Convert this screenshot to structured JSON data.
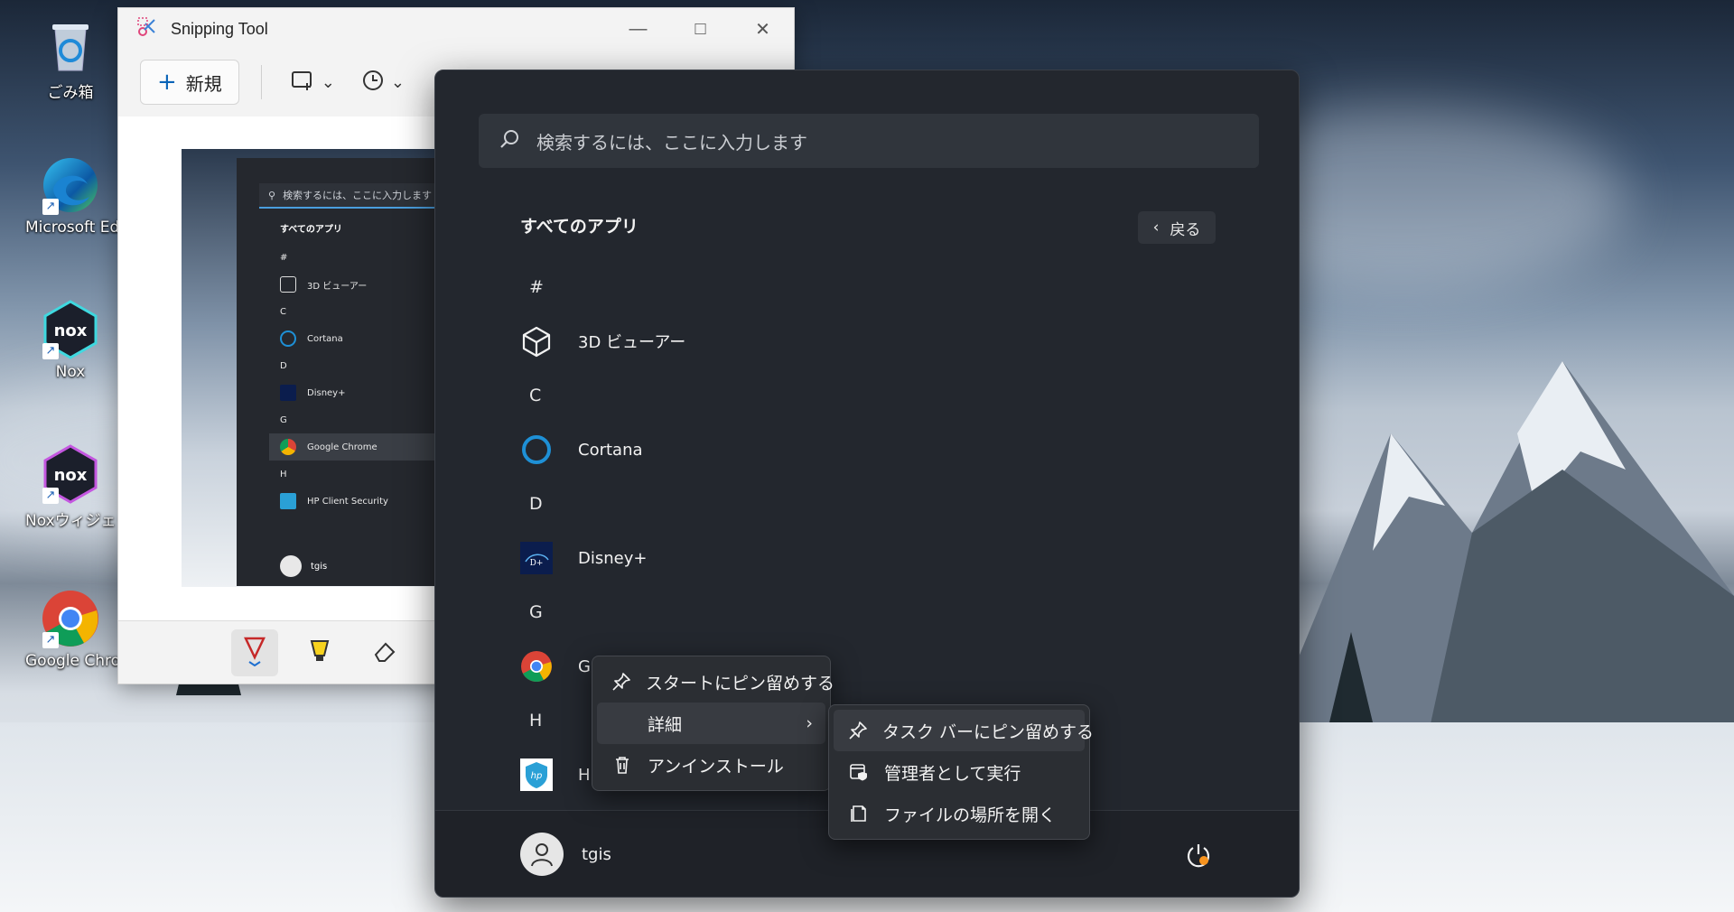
{
  "desktop": {
    "icons": [
      {
        "label": "ごみ箱",
        "icon": "recycle-bin-icon"
      },
      {
        "label": "Microsoft Edg",
        "icon": "edge-icon"
      },
      {
        "label": "Nox",
        "icon": "nox-icon"
      },
      {
        "label": "Noxウィジェット",
        "icon": "nox-widget-icon"
      },
      {
        "label": "Google Chrom",
        "icon": "chrome-icon"
      }
    ]
  },
  "snipping_tool": {
    "title": "Snipping Tool",
    "new_label": "新規",
    "preview": {
      "search_placeholder": "検索するには、ここに入力します",
      "section_title": "すべてのアプリ",
      "items": [
        {
          "text": "#",
          "kind": "letter"
        },
        {
          "text": "3D ビューアー",
          "kind": "app"
        },
        {
          "text": "C",
          "kind": "letter"
        },
        {
          "text": "Cortana",
          "kind": "app"
        },
        {
          "text": "D",
          "kind": "letter"
        },
        {
          "text": "Disney+",
          "kind": "app"
        },
        {
          "text": "G",
          "kind": "letter"
        },
        {
          "text": "Google Chrome",
          "kind": "app"
        },
        {
          "text": "H",
          "kind": "letter"
        },
        {
          "text": "HP Client Security",
          "kind": "app"
        }
      ],
      "user": "tgis"
    }
  },
  "start_menu": {
    "search_placeholder": "検索するには、ここに入力します",
    "section_title": "すべてのアプリ",
    "back_label": "戻る",
    "list": [
      {
        "text": "#",
        "kind": "letter"
      },
      {
        "text": "3D ビューアー",
        "kind": "app",
        "icon": "3d-viewer-icon"
      },
      {
        "text": "C",
        "kind": "letter"
      },
      {
        "text": "Cortana",
        "kind": "app",
        "icon": "cortana-icon"
      },
      {
        "text": "D",
        "kind": "letter"
      },
      {
        "text": "Disney+",
        "kind": "app",
        "icon": "disney-plus-icon"
      },
      {
        "text": "G",
        "kind": "letter"
      },
      {
        "text": "G",
        "kind": "app",
        "icon": "chrome-icon"
      },
      {
        "text": "H",
        "kind": "letter"
      },
      {
        "text": "H",
        "kind": "app",
        "icon": "hp-client-security-icon"
      }
    ],
    "user_name": "tgis"
  },
  "context_menu": {
    "items": [
      {
        "label": "スタートにピン留めする",
        "icon": "pin-icon"
      },
      {
        "label": "詳細",
        "icon": "",
        "submenu": true
      },
      {
        "label": "アンインストール",
        "icon": "trash-icon"
      }
    ]
  },
  "submenu": {
    "items": [
      {
        "label": "タスク バーにピン留めする",
        "icon": "pin-icon"
      },
      {
        "label": "管理者として実行",
        "icon": "admin-shield-icon"
      },
      {
        "label": "ファイルの場所を開く",
        "icon": "file-location-icon"
      }
    ]
  },
  "colors": {
    "start_bg": "#23272e",
    "accent_blue": "#1e90d6",
    "update_badge": "#f7931e"
  }
}
